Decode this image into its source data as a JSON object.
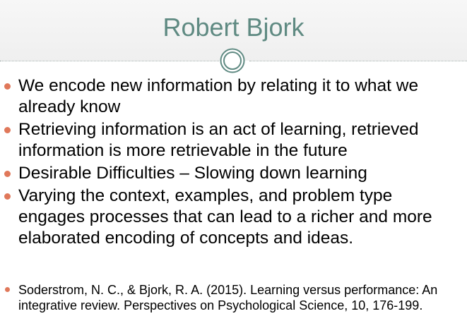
{
  "slide": {
    "title": "Robert Bjork",
    "bullets": [
      "We encode new information by relating it to what we already know",
      "Retrieving information is an act of learning, retrieved information is more retrievable in the future",
      "Desirable Difficulties – Slowing down learning",
      "Varying the context, examples, and problem type engages processes that can lead to a richer and more elaborated encoding of concepts and ideas."
    ],
    "reference": "Soderstrom, N. C., & Bjork, R. A. (2015).  Learning versus performance: An integrative review.  Perspectives on Psychological Science, 10, 176-199."
  },
  "colors": {
    "title": "#5f8a82",
    "bullet_marker": "#e0785a",
    "ornament": "#5f8a82",
    "body_text": "#000000"
  },
  "icons": {
    "ornament": "double-circle-ornament-icon",
    "bullet": "round-bullet-icon"
  }
}
